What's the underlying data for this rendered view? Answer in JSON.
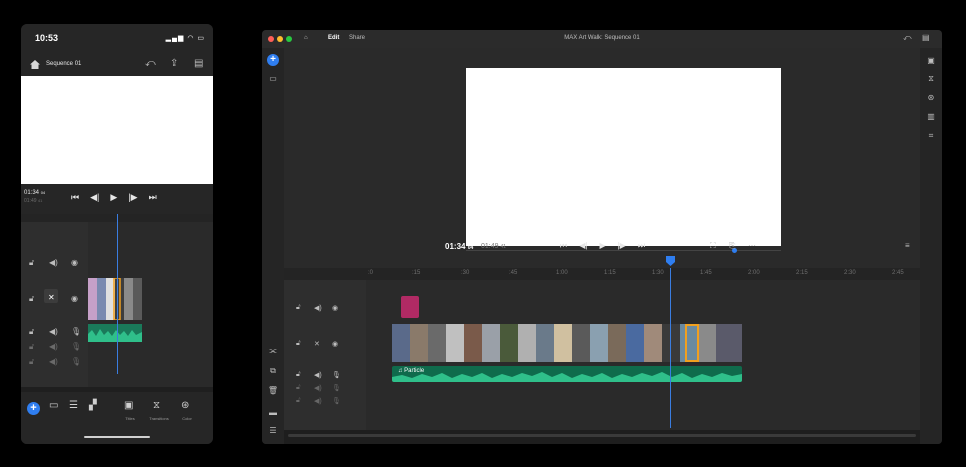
{
  "phone": {
    "status_time": "10:53",
    "sequence_title": "Sequence 01",
    "timecode": "01:34",
    "timecode_frames": "04",
    "duration": "01:49",
    "duration_frames": "41",
    "tools": [
      {
        "label": "Titles",
        "icon": "titles-icon"
      },
      {
        "label": "Transitions",
        "icon": "transitions-icon"
      },
      {
        "label": "Color",
        "icon": "color-icon"
      }
    ]
  },
  "desktop": {
    "tabs": [
      "Edit",
      "Share"
    ],
    "window_title": "MAX Art Walk: Sequence 01",
    "timecode": "01:34",
    "timecode_frames": "04",
    "duration": "01:49",
    "duration_frames": "41",
    "ruler_ticks": [
      ":0",
      ":15",
      ":30",
      ":45",
      "1:00",
      "1:15",
      "1:30",
      "1:45",
      "2:00",
      "2:15",
      "2:30",
      "2:45"
    ],
    "audio_clip_label": "Particle",
    "colors": {
      "accent": "#2f7ef0",
      "audio_clip": "#0f6b4c",
      "graphic_clip": "#b02a64",
      "playhead": "#3a7de0"
    }
  }
}
